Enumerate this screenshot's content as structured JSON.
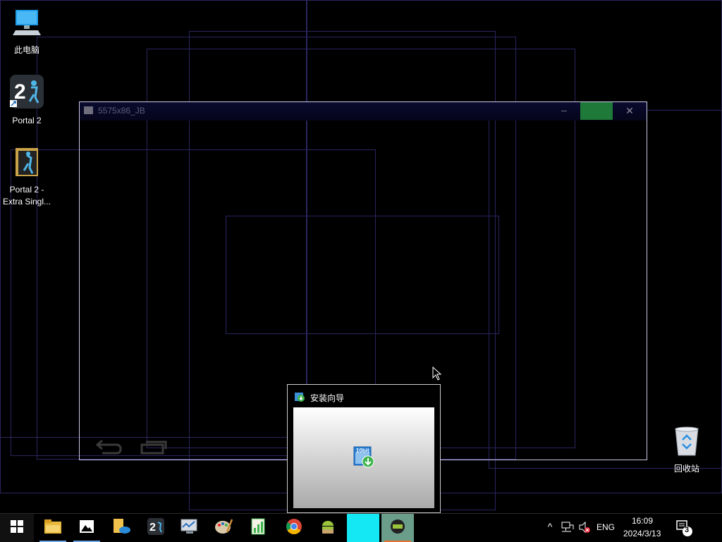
{
  "desktop": {
    "icons": [
      {
        "label": "此电脑",
        "icon": "computer-icon"
      },
      {
        "label": "Portal 2",
        "icon": "portal2-game-icon"
      },
      {
        "label": "Portal 2 - Extra Singl...",
        "icon": "portal2-folder-icon"
      },
      {
        "label": "回收站",
        "icon": "recycle-bin-icon"
      }
    ]
  },
  "emulator_window": {
    "title": "5575x86_JB",
    "minimize": "–",
    "close": "✕",
    "nav_back": "back-arrow-icon",
    "nav_recents": "recent-apps-icon"
  },
  "popup": {
    "title": "安装向导",
    "icon": "10bit-installer-icon",
    "badge": "10bit"
  },
  "taskbar": {
    "start": "windows-start-icon",
    "apps": [
      {
        "name": "file-explorer-icon",
        "running": true
      },
      {
        "name": "photos-icon",
        "running": true
      },
      {
        "name": "onedrive-folder-icon",
        "running": false
      },
      {
        "name": "portal2-taskbar-icon",
        "running": false
      },
      {
        "name": "system-monitor-icon",
        "running": false
      },
      {
        "name": "paint-icon",
        "running": false
      },
      {
        "name": "chart-document-icon",
        "running": false
      },
      {
        "name": "chrome-icon",
        "running": false
      },
      {
        "name": "android-icon",
        "running": false
      },
      {
        "name": "cyan-app-icon",
        "running": true
      },
      {
        "name": "and-emulator-icon",
        "running": true
      }
    ],
    "tray": {
      "chevron": "^",
      "language": "ENG",
      "time": "16:09",
      "date": "2024/3/13",
      "notifications": "3"
    }
  },
  "colors": {
    "ghost_border": "#2a2560",
    "emulator_border": "#c9c9e6",
    "maximize_green": "#1f7a3a",
    "taskbar_cyan": "#14e8f5",
    "taskbar_accent": "#6aa6e8"
  }
}
